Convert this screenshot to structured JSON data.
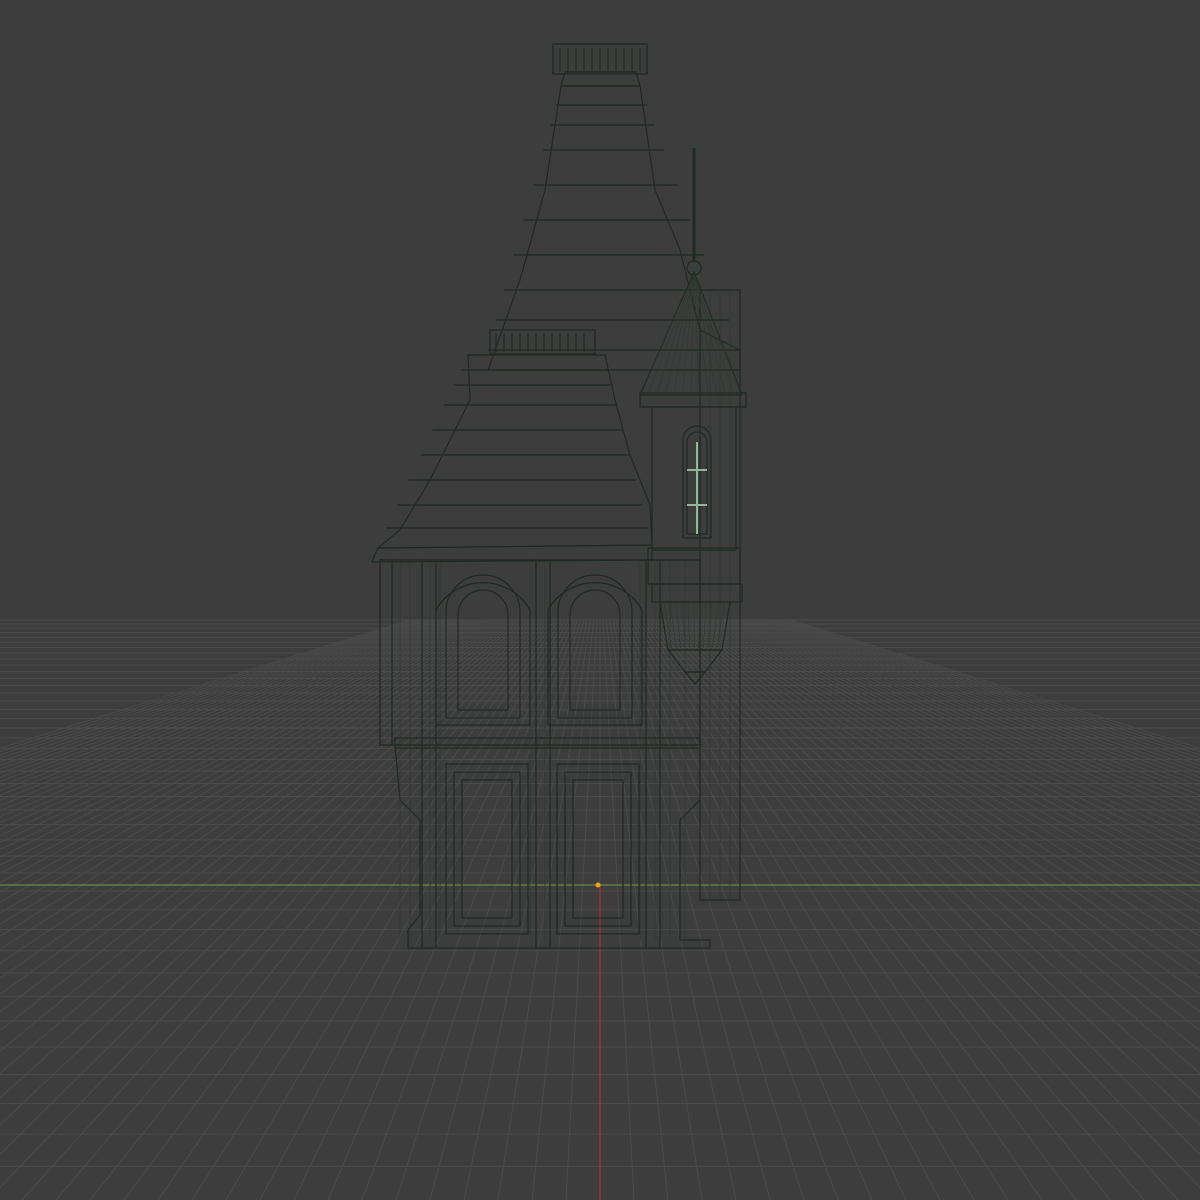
{
  "viewport": {
    "background": "#3d3d3d",
    "grid_color": "#4a4a4a",
    "x_axis_color": "#7a9a3a",
    "y_axis_color": "#c0303a",
    "mesh_fill": "#8fb89a",
    "wire_color": "#1f2a22",
    "origin_marker_color": "#f0a020"
  },
  "object": {
    "kind": "victorian-house-model",
    "display": "solid-with-wireframe",
    "view": "front-orthographic"
  }
}
